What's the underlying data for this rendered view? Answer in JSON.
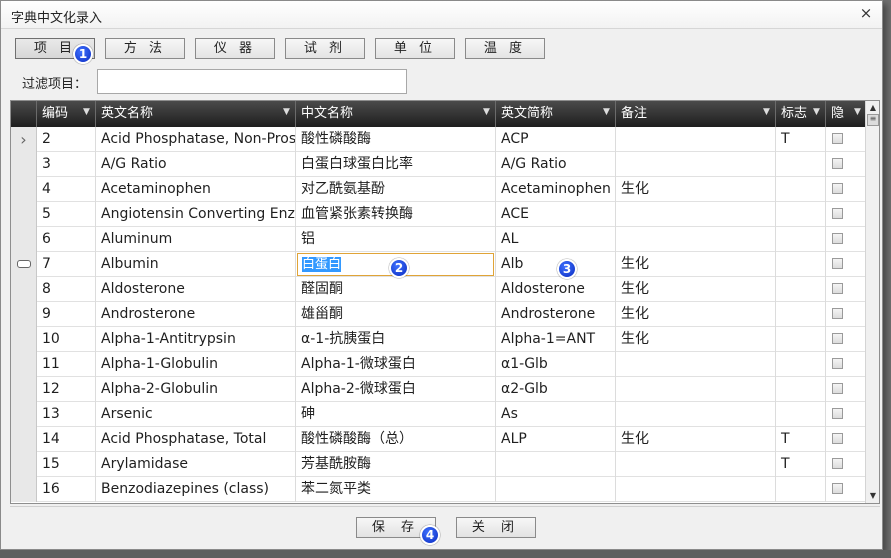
{
  "window": {
    "title": "字典中文化录入",
    "close_glyph": "×"
  },
  "tabs": [
    {
      "label": "项 目",
      "active": true
    },
    {
      "label": "方 法",
      "active": false
    },
    {
      "label": "仪 器",
      "active": false
    },
    {
      "label": "试 剂",
      "active": false
    },
    {
      "label": "单 位",
      "active": false
    },
    {
      "label": "温 度",
      "active": false
    }
  ],
  "filter": {
    "label": "过滤项目：",
    "value": ""
  },
  "grid": {
    "columns": [
      "编码",
      "英文名称",
      "中文名称",
      "英文简称",
      "备注",
      "标志",
      "隐"
    ],
    "rows": [
      {
        "indicator": "current-arrow",
        "code": "2",
        "en": "Acid Phosphatase, Non-Prostatic",
        "zh": "酸性磷酸酶",
        "abbr": "ACP",
        "note": "",
        "flag": "T"
      },
      {
        "indicator": "",
        "code": "3",
        "en": "A/G Ratio",
        "zh": "白蛋白球蛋白比率",
        "abbr": "A/G Ratio",
        "note": "",
        "flag": ""
      },
      {
        "indicator": "",
        "code": "4",
        "en": "Acetaminophen",
        "zh": "对乙酰氨基酚",
        "abbr": "Acetaminophen",
        "note": "生化",
        "flag": ""
      },
      {
        "indicator": "",
        "code": "5",
        "en": "Angiotensin Converting Enzyme",
        "zh": "血管紧张素转换酶",
        "abbr": "ACE",
        "note": "",
        "flag": ""
      },
      {
        "indicator": "",
        "code": "6",
        "en": "Aluminum",
        "zh": "铝",
        "abbr": "AL",
        "note": "",
        "flag": ""
      },
      {
        "indicator": "editing",
        "code": "7",
        "en": "Albumin",
        "zh": "白蛋白",
        "abbr": "Alb",
        "note": "生化",
        "flag": ""
      },
      {
        "indicator": "",
        "code": "8",
        "en": "Aldosterone",
        "zh": "醛固酮",
        "abbr": "Aldosterone",
        "note": "生化",
        "flag": ""
      },
      {
        "indicator": "",
        "code": "9",
        "en": "Androsterone",
        "zh": "雄甾酮",
        "abbr": "Androsterone",
        "note": "生化",
        "flag": ""
      },
      {
        "indicator": "",
        "code": "10",
        "en": "Alpha-1-Antitrypsin",
        "zh": "α-1-抗胰蛋白",
        "abbr": "Alpha-1=ANT",
        "note": "生化",
        "flag": ""
      },
      {
        "indicator": "",
        "code": "11",
        "en": "Alpha-1-Globulin",
        "zh": "Alpha-1-微球蛋白",
        "abbr": "α1-Glb",
        "note": "",
        "flag": ""
      },
      {
        "indicator": "",
        "code": "12",
        "en": "Alpha-2-Globulin",
        "zh": "Alpha-2-微球蛋白",
        "abbr": "α2-Glb",
        "note": "",
        "flag": ""
      },
      {
        "indicator": "",
        "code": "13",
        "en": "Arsenic",
        "zh": "砷",
        "abbr": "As",
        "note": "",
        "flag": ""
      },
      {
        "indicator": "",
        "code": "14",
        "en": "Acid Phosphatase, Total",
        "zh": "酸性磷酸酶（总）",
        "abbr": "ALP",
        "note": "生化",
        "flag": "T"
      },
      {
        "indicator": "",
        "code": "15",
        "en": "Arylamidase",
        "zh": "芳基酰胺酶",
        "abbr": "",
        "note": "",
        "flag": "T"
      },
      {
        "indicator": "",
        "code": "16",
        "en": "Benzodiazepines (class)",
        "zh": "苯二氮平类",
        "abbr": "",
        "note": "",
        "flag": ""
      }
    ]
  },
  "buttons": {
    "save": "保 存",
    "close": "关 闭"
  },
  "badges": [
    "1",
    "2",
    "3",
    "4"
  ],
  "icons": {
    "filter": "▼",
    "arrow": "›",
    "scroll_up": "▲",
    "scroll_down": "▼",
    "scroll_grip": "≡"
  }
}
